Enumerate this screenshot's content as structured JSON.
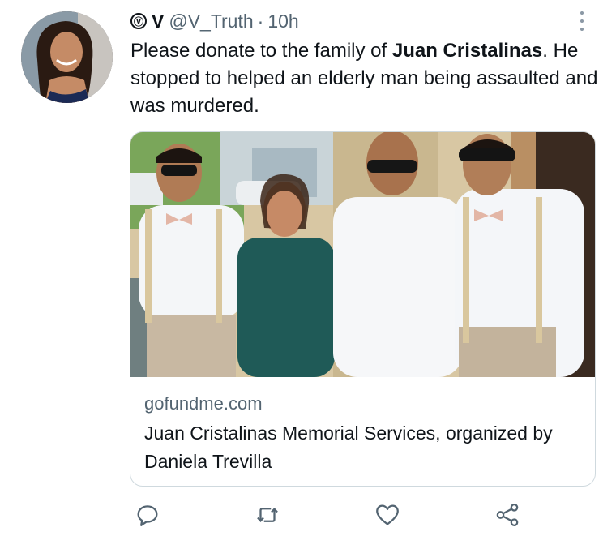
{
  "tweet": {
    "verified_glyph": "Ⓥ",
    "display_name": "V",
    "handle": "@V_Truth",
    "separator": "·",
    "time": "10h",
    "text_before": "Please donate to the family of ",
    "text_bold": "Juan Cristalinas",
    "text_after": ". He stopped to helped an elderly man being assaulted and was murdered."
  },
  "card": {
    "domain": "gofundme.com",
    "title": "Juan Cristalinas Memorial Services, organized by Daniela Trevilla"
  },
  "actions": [
    {
      "name": "reply",
      "icon": "reply-icon"
    },
    {
      "name": "retweet",
      "icon": "retweet-icon"
    },
    {
      "name": "like",
      "icon": "heart-icon"
    },
    {
      "name": "share",
      "icon": "share-icon"
    }
  ],
  "colors": {
    "text": "#0f1419",
    "secondary": "#536471",
    "border": "#cfd9de"
  }
}
